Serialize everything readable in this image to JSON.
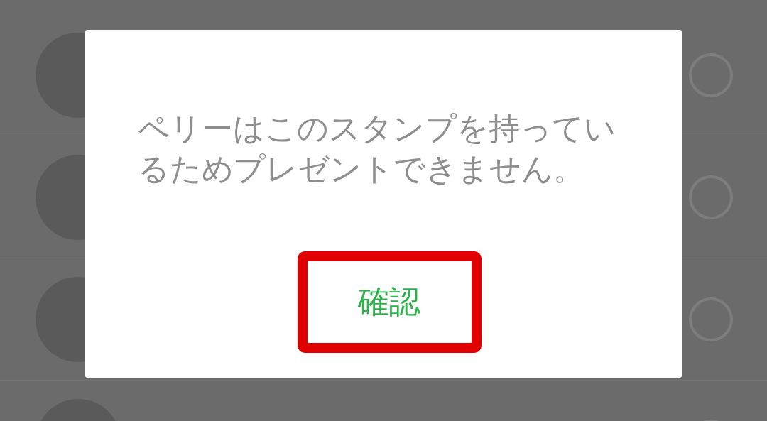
{
  "list": {
    "rows": [
      {
        "selected": false
      },
      {
        "selected": false
      },
      {
        "selected": false
      },
      {
        "selected": false
      }
    ]
  },
  "dialog": {
    "message": "ペリーはこのスタンプを持っているためプレゼントできません。",
    "button": "確認",
    "highlighted": true
  }
}
